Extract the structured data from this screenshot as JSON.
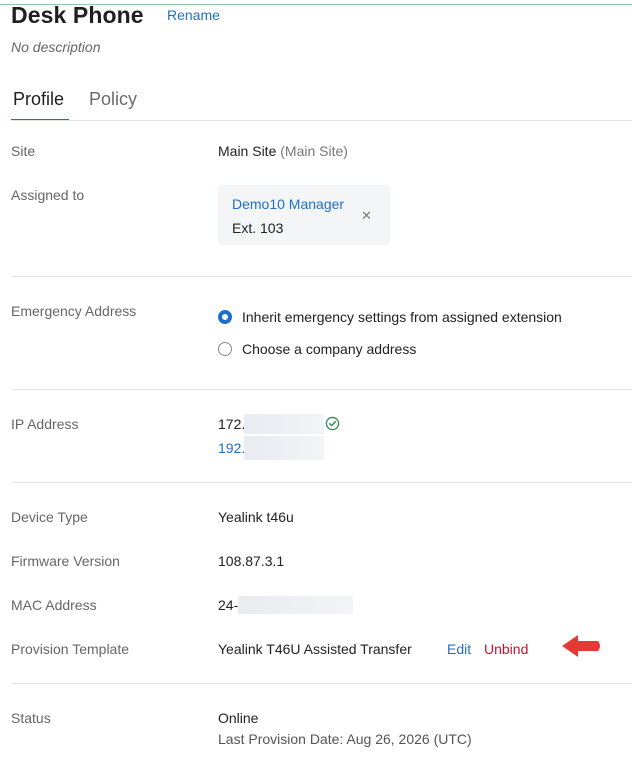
{
  "header": {
    "title": "Desk Phone",
    "rename_label": "Rename",
    "description": "No description"
  },
  "tabs": [
    {
      "label": "Profile",
      "active": true
    },
    {
      "label": "Policy",
      "active": false
    }
  ],
  "fields": {
    "site": {
      "label": "Site",
      "value": "Main Site",
      "secondary": "(Main Site)"
    },
    "assigned_to": {
      "label": "Assigned to",
      "name": "Demo10 Manager",
      "ext": "Ext. 103",
      "remove_icon": "close-icon"
    },
    "emergency": {
      "label": "Emergency Address",
      "options": [
        {
          "label": "Inherit emergency settings from assigned extension",
          "selected": true
        },
        {
          "label": "Choose a company address",
          "selected": false
        }
      ]
    },
    "ip": {
      "label": "IP Address",
      "ip1_prefix": "172.",
      "ip2_prefix": "192.",
      "status_icon": "check-circle-icon"
    },
    "device_type": {
      "label": "Device Type",
      "value": "Yealink t46u"
    },
    "firmware": {
      "label": "Firmware Version",
      "value": "108.87.3.1"
    },
    "mac": {
      "label": "MAC Address",
      "value_prefix": "24-"
    },
    "provision": {
      "label": "Provision Template",
      "value": "Yealink T46U Assisted Transfer",
      "edit_label": "Edit",
      "unbind_label": "Unbind"
    },
    "status": {
      "label": "Status",
      "value": "Online",
      "last_provision": "Last Provision Date: Aug 26, 2026 (UTC)"
    }
  },
  "colors": {
    "accent": "#1e6fc9",
    "danger": "#c8102e",
    "success": "#2e8b57",
    "annotation_arrow": "#e53935"
  }
}
